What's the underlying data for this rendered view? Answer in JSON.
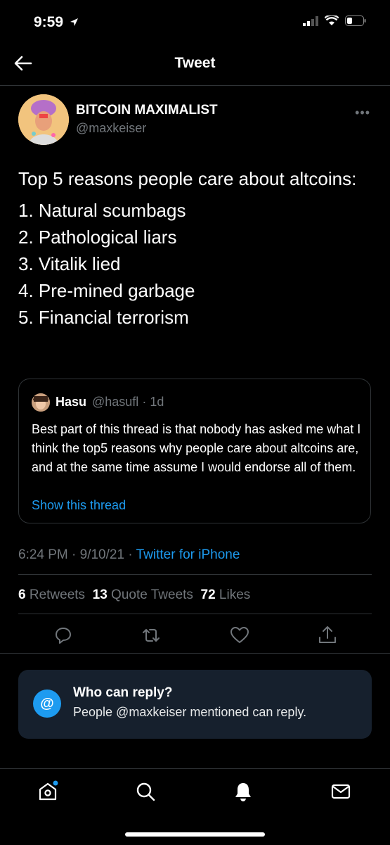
{
  "status_bar": {
    "time": "9:59"
  },
  "header": {
    "title": "Tweet"
  },
  "author": {
    "name": "BITCOIN MAXIMALIST",
    "handle": "@maxkeiser"
  },
  "tweet": {
    "intro": "Top 5 reasons people care about altcoins:",
    "items": [
      "1. Natural scumbags",
      "2. Pathological liars",
      "3. Vitalik lied",
      "4. Pre-mined garbage",
      "5. Financial terrorism"
    ]
  },
  "quote": {
    "name": "Hasu",
    "handle": "@hasufl",
    "age": "· 1d",
    "text": "Best part of this thread is that nobody has asked me what I think the top5 reasons why people care about altcoins are, and at the same time assume I would endorse all of them.",
    "link": "Show this thread"
  },
  "meta": {
    "time": "6:24 PM · 9/10/21 ·",
    "app": "Twitter for iPhone"
  },
  "stats": {
    "retweets_count": "6",
    "retweets_label": "Retweets",
    "quotes_count": "13",
    "quotes_label": "Quote Tweets",
    "likes_count": "72",
    "likes_label": "Likes"
  },
  "actions": [
    "reply-icon",
    "retweet-icon",
    "like-icon",
    "share-icon"
  ],
  "who_can_reply": {
    "icon": "@",
    "title": "Who can reply?",
    "subtitle": "People @maxkeiser mentioned can reply."
  },
  "tabs": [
    "home-icon",
    "search-icon",
    "notifications-icon",
    "messages-icon"
  ],
  "colors": {
    "accent": "#1d9bf0",
    "muted": "#71767b",
    "card": "#16202d"
  }
}
